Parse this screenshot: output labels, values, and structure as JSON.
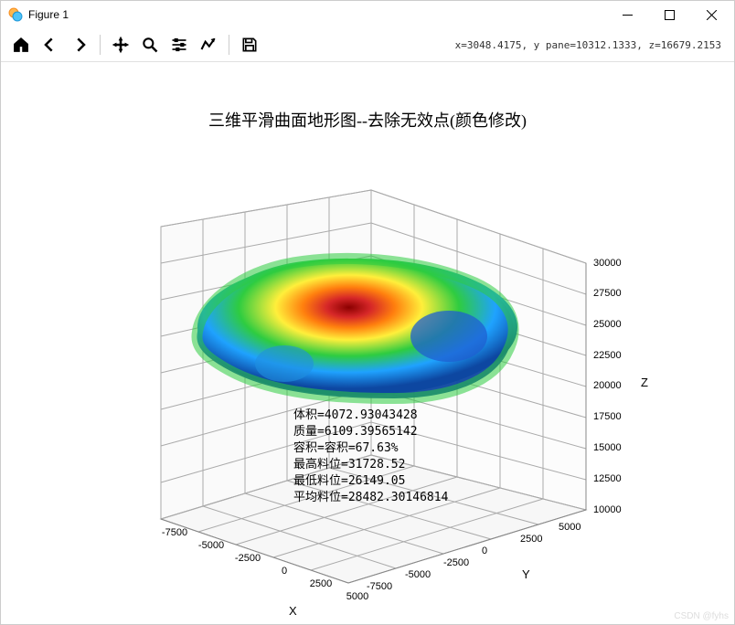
{
  "window": {
    "title": "Figure 1",
    "status": "x=3048.4175, y pane=10312.1333, z=16679.2153"
  },
  "toolbar": {
    "home": "home-icon",
    "back": "back-icon",
    "forward": "forward-icon",
    "pan": "pan-icon",
    "zoom": "zoom-icon",
    "config": "config-subplots-icon",
    "edit": "edit-axes-icon",
    "save": "save-icon"
  },
  "chart_data": {
    "type": "surface",
    "title": "三维平滑曲面地形图--去除无效点(颜色修改)",
    "xlabel": "X",
    "ylabel": "Y",
    "zlabel": "Z",
    "x_ticks": [
      -7500,
      -5000,
      -2500,
      0,
      2500,
      5000
    ],
    "y_ticks": [
      -7500,
      -5000,
      -2500,
      0,
      2500,
      5000
    ],
    "z_ticks": [
      10000,
      12500,
      15000,
      17500,
      20000,
      22500,
      25000,
      27500,
      30000
    ],
    "x_range": [
      -7500,
      5000
    ],
    "y_range": [
      -7500,
      5000
    ],
    "z_range": [
      10000,
      30000
    ],
    "colormap": "jet",
    "annotations": [
      "体积=4072.93043428",
      "质量=6109.39565142",
      "容积=容积=67.63%",
      "最高料位=31728.52",
      "最低料位=26149.05",
      "平均料位=28482.30146814"
    ],
    "surface_summary": {
      "volume": 4072.93043428,
      "mass": 6109.39565142,
      "capacity_pct": 67.63,
      "z_max": 31728.52,
      "z_min": 26149.05,
      "z_mean": 28482.30146814
    }
  },
  "watermark": "CSDN @fyhs"
}
